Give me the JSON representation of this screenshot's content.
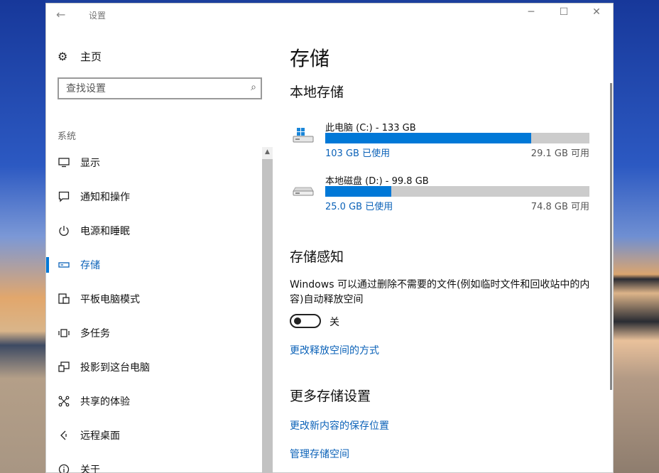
{
  "window": {
    "title": "设置",
    "back_icon": "back-arrow-icon"
  },
  "nav": {
    "home_label": "主页",
    "search_placeholder": "查找设置",
    "section_label": "系统",
    "items": [
      {
        "label": "显示",
        "icon": "monitor-icon"
      },
      {
        "label": "通知和操作",
        "icon": "notification-icon"
      },
      {
        "label": "电源和睡眠",
        "icon": "power-icon"
      },
      {
        "label": "存储",
        "icon": "storage-icon",
        "active": true
      },
      {
        "label": "平板电脑模式",
        "icon": "tablet-mode-icon"
      },
      {
        "label": "多任务",
        "icon": "multitask-icon"
      },
      {
        "label": "投影到这台电脑",
        "icon": "project-icon"
      },
      {
        "label": "共享的体验",
        "icon": "shared-experience-icon"
      },
      {
        "label": "远程桌面",
        "icon": "remote-desktop-icon"
      },
      {
        "label": "关于",
        "icon": "info-icon"
      }
    ]
  },
  "page": {
    "title": "存储",
    "local_storage_heading": "本地存储",
    "drives": [
      {
        "name": "此电脑 (C:) - 133 GB",
        "used": "103 GB 已使用",
        "free": "29.1 GB 可用",
        "used_fraction": 0.78
      },
      {
        "name": "本地磁盘 (D:) - 99.8 GB",
        "used": "25.0 GB 已使用",
        "free": "74.8 GB 可用",
        "used_fraction": 0.25
      }
    ],
    "sense_heading": "存储感知",
    "sense_description": "Windows 可以通过删除不需要的文件(例如临时文件和回收站中的内容)自动释放空间",
    "toggle_label": "关",
    "toggle_on": false,
    "link_change_free": "更改释放空间的方式",
    "more_heading": "更多存储设置",
    "link_save_location": "更改新内容的保存位置",
    "link_manage_spaces": "管理存储空间"
  },
  "colors": {
    "accent": "#0078d7",
    "link": "#0b62b8",
    "bar_bg": "#cccccc"
  }
}
